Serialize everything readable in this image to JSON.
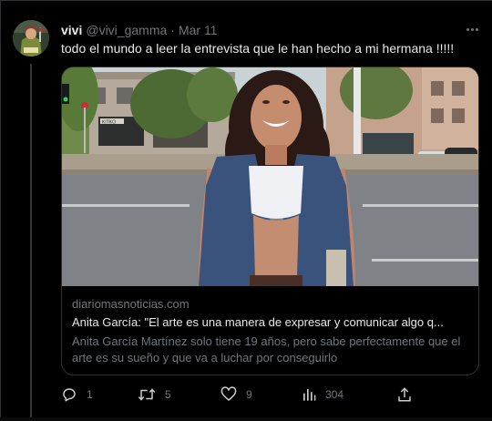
{
  "tweet": {
    "author_name": "vivi",
    "handle": "@vivi_gamma",
    "separator": "·",
    "date": "Mar 11",
    "text": "todo el mundo a leer la entrevista que le han hecho a mi hermana !!!!!"
  },
  "link_card": {
    "domain": "diariomasnoticias.com",
    "title": "Anita García: \"El arte es una manera de expresar y comunicar algo q...",
    "description": "Anita García Martínez solo tiene 19 años, pero sabe perfectamente que el arte es su sueño y que va a luchar por conseguirlo",
    "storefront_sign": "KITKO"
  },
  "actions": {
    "replies": "1",
    "retweets": "5",
    "likes": "9",
    "views": "304"
  },
  "icons": {
    "more": "more-horizontal-icon",
    "reply": "reply-icon",
    "retweet": "retweet-icon",
    "like": "heart-icon",
    "views": "views-chart-icon",
    "share": "share-icon"
  },
  "colors": {
    "background": "#000000",
    "text_primary": "#e7e9ea",
    "text_secondary": "#71767b",
    "border": "#2f3336"
  }
}
